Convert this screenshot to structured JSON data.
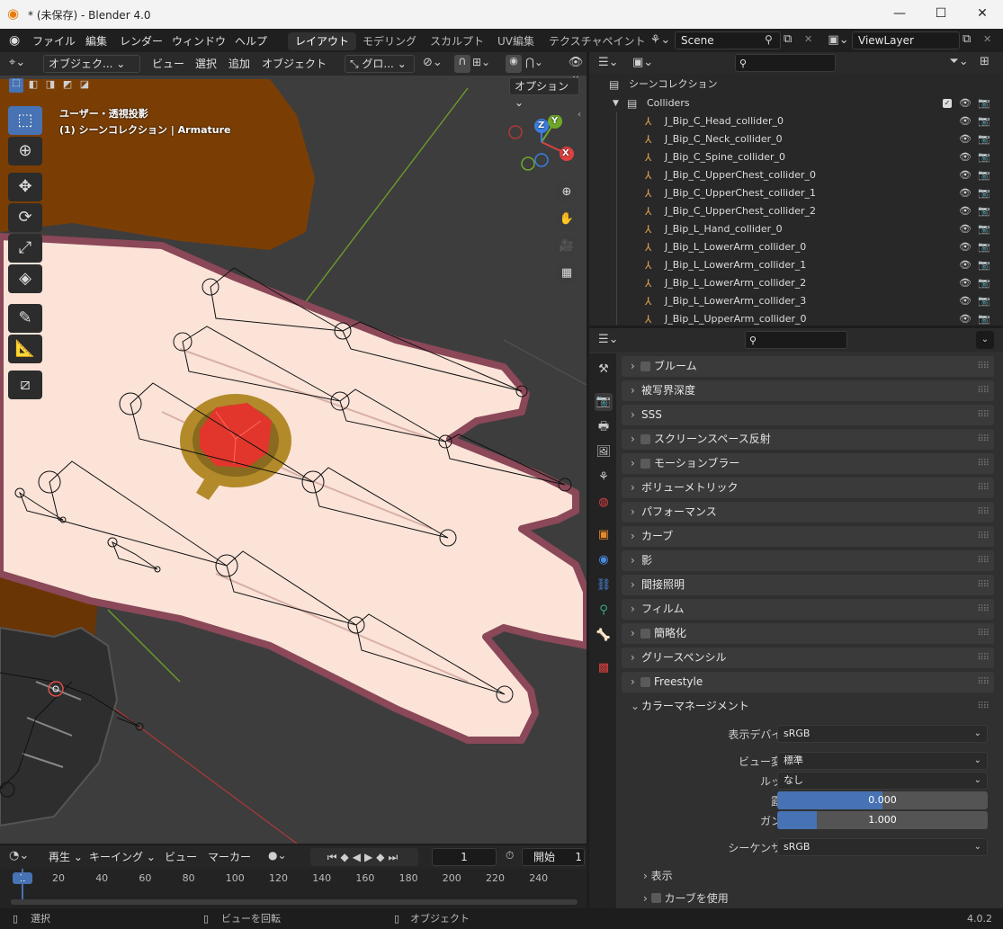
{
  "window": {
    "title": "* (未保存) - Blender 4.0",
    "minimize": "—",
    "maximize": "☐",
    "close": "✕"
  },
  "menu": {
    "items": [
      "ファイル",
      "編集",
      "レンダー",
      "ウィンドウ",
      "ヘルプ"
    ],
    "workspaces": [
      "レイアウト",
      "モデリング",
      "スカルプト",
      "UV編集",
      "テクスチャペイント"
    ],
    "scene": "Scene",
    "view_layer": "ViewLayer"
  },
  "viewport": {
    "mode": "オブジェク...",
    "menus": [
      "ビュー",
      "選択",
      "追加",
      "オブジェクト"
    ],
    "transform_orientation": "グロ...",
    "options": "オプション",
    "overlay_line1": "ユーザー・透視投影",
    "overlay_line2": "(1) シーンコレクション | Armature",
    "gizmo": {
      "x": "X",
      "y": "Y",
      "z": "Z"
    }
  },
  "timeline": {
    "playback": "再生",
    "keying": "キーイング",
    "view": "ビュー",
    "marker": "マーカー",
    "current_frame": "1",
    "start_label": "開始",
    "start_value": "1",
    "ruler": [
      "1",
      "20",
      "40",
      "60",
      "80",
      "100",
      "120",
      "140",
      "160",
      "180",
      "200",
      "220",
      "240"
    ]
  },
  "outliner": {
    "root": "シーンコレクション",
    "collection": "Colliders",
    "items": [
      "J_Bip_C_Head_collider_0",
      "J_Bip_C_Neck_collider_0",
      "J_Bip_C_Spine_collider_0",
      "J_Bip_C_UpperChest_collider_0",
      "J_Bip_C_UpperChest_collider_1",
      "J_Bip_C_UpperChest_collider_2",
      "J_Bip_L_Hand_collider_0",
      "J_Bip_L_LowerArm_collider_0",
      "J_Bip_L_LowerArm_collider_1",
      "J_Bip_L_LowerArm_collider_2",
      "J_Bip_L_LowerArm_collider_3",
      "J_Bip_L_UpperArm_collider_0"
    ]
  },
  "properties": {
    "panels": [
      {
        "label": "ブルーム",
        "checkbox": true
      },
      {
        "label": "被写界深度",
        "checkbox": false
      },
      {
        "label": "SSS",
        "checkbox": false
      },
      {
        "label": "スクリーンスペース反射",
        "checkbox": true
      },
      {
        "label": "モーションブラー",
        "checkbox": true
      },
      {
        "label": "ボリューメトリック",
        "checkbox": false
      },
      {
        "label": "パフォーマンス",
        "checkbox": false
      },
      {
        "label": "カーブ",
        "checkbox": false
      },
      {
        "label": "影",
        "checkbox": false
      },
      {
        "label": "間接照明",
        "checkbox": false
      },
      {
        "label": "フィルム",
        "checkbox": false
      },
      {
        "label": "簡略化",
        "checkbox": true
      },
      {
        "label": "グリースペンシル",
        "checkbox": false
      },
      {
        "label": "Freestyle",
        "checkbox": true
      },
      {
        "label": "カラーマネージメント",
        "checkbox": false,
        "expanded": true
      }
    ],
    "color_management": {
      "display_device_label": "表示デバイス",
      "display_device": "sRGB",
      "view_transform_label": "ビュー変換",
      "view_transform": "標準",
      "look_label": "ルック",
      "look": "なし",
      "exposure_label": "露出",
      "exposure": "0.000",
      "exposure_fill": 0.5,
      "gamma_label": "ガンマ",
      "gamma": "1.000",
      "gamma_fill": 0.19,
      "sequencer_label": "シーケンサー",
      "sequencer": "sRGB",
      "sub_display": "表示",
      "sub_curves": "カーブを使用"
    }
  },
  "status": {
    "select": "選択",
    "rotate": "ビューを回転",
    "object": "オブジェクト",
    "version": "4.0.2"
  },
  "colors": {
    "accent": "#4772b3",
    "skin": "#fbe3d8",
    "skin_outline": "#8a4858",
    "hair": "#7a3e05",
    "gem": "#e2362c",
    "gold": "#b38a2a"
  }
}
